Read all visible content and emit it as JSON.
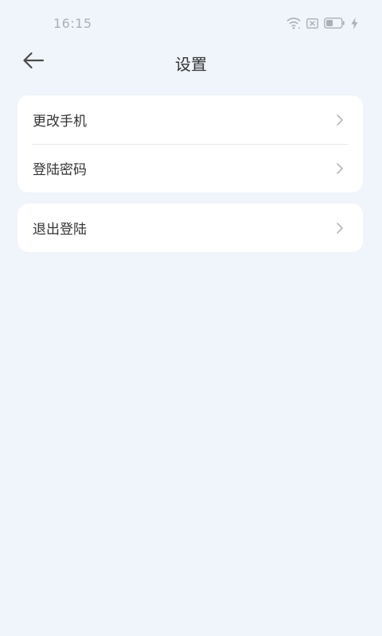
{
  "status_bar": {
    "time": "16:15",
    "icons": [
      "wifi-icon",
      "sim-blocked-icon",
      "battery-icon",
      "charging-bolt-icon"
    ]
  },
  "header": {
    "back_icon": "arrow-left-icon",
    "title": "设置"
  },
  "settings_groups": [
    {
      "items": [
        {
          "label": "更改手机",
          "icon": "chevron-right-icon"
        },
        {
          "label": "登陆密码",
          "icon": "chevron-right-icon"
        }
      ]
    },
    {
      "items": [
        {
          "label": "退出登陆",
          "icon": "chevron-right-icon"
        }
      ]
    }
  ],
  "colors": {
    "background": "#eff5fa",
    "card": "#ffffff",
    "text": "#333333",
    "muted": "#a9b0b7"
  }
}
